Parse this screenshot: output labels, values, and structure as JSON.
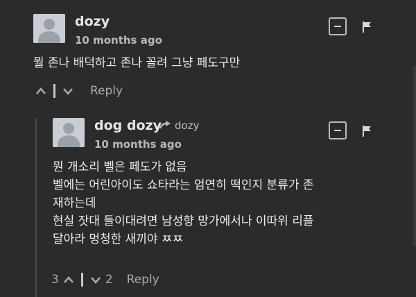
{
  "comment1": {
    "author": "dozy",
    "time": "10 months ago",
    "text": "뭘 존나 배덕하고 존나 꼴려 그냥 페도구만",
    "reply_label": "Reply"
  },
  "comment2": {
    "author": "dog dozy",
    "reply_to": "dozy",
    "time": "10 months ago",
    "lines": [
      "뭔 개소리 벨은 페도가 없음",
      "벨에는 어린아이도 쇼타라는 엄연히 떡인지 분류가 존",
      "재하는데",
      "현실 잣대 들이대려면 남성향 망가에서나 이따위 리플",
      "달아라 멍청한 새끼야 ㅉㅉ"
    ],
    "upvotes": "3",
    "downvotes": "2",
    "reply_label": "Reply"
  }
}
